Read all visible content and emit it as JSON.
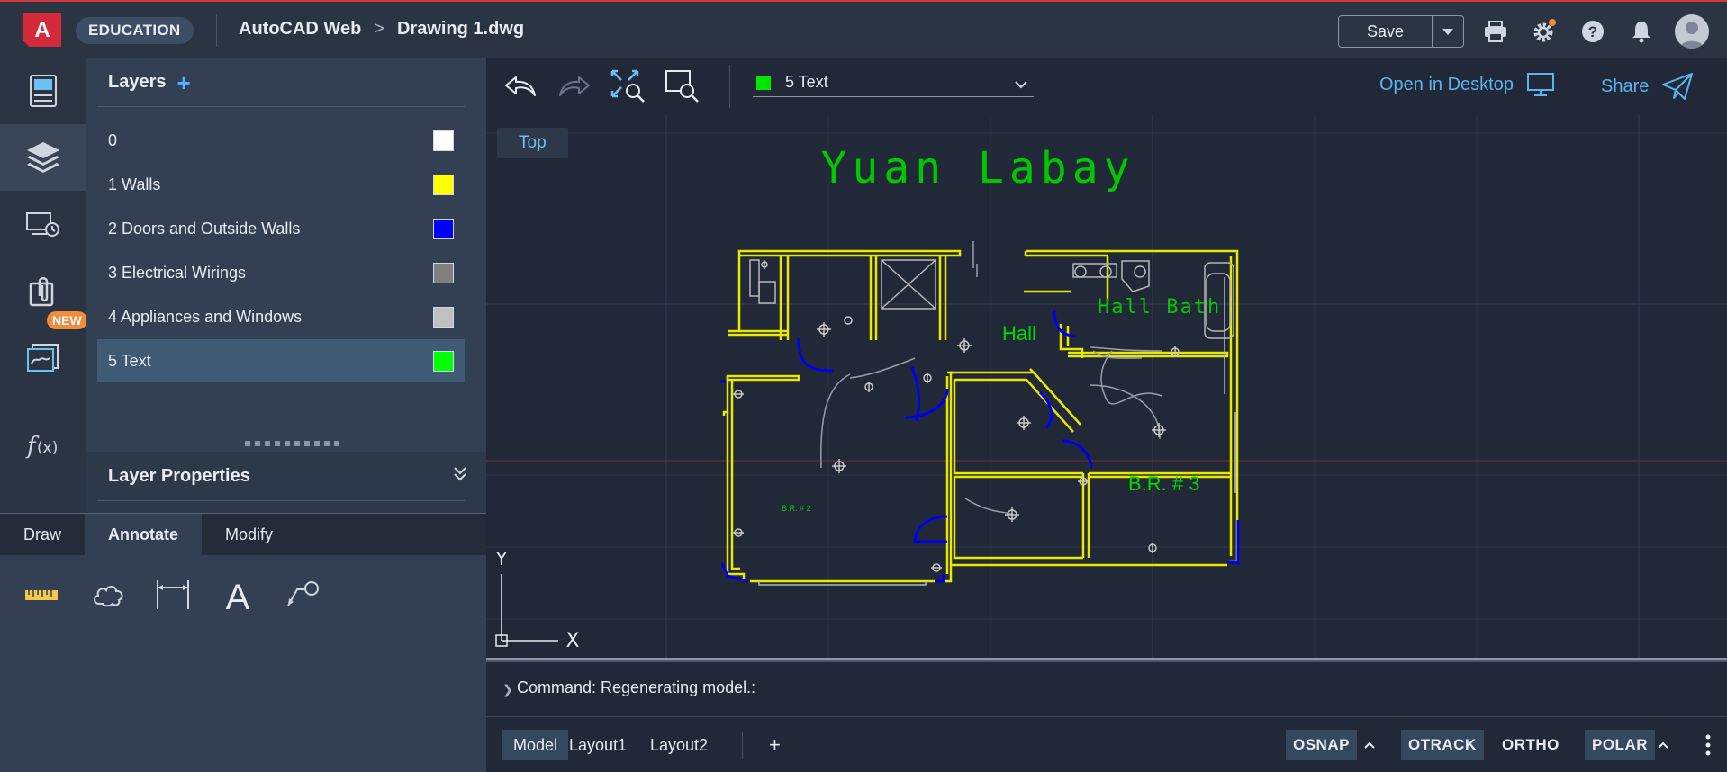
{
  "app": {
    "logo_letter": "A",
    "badge": "EDUCATION",
    "product": "AutoCAD Web",
    "file": "Drawing 1.dwg",
    "save_label": "Save"
  },
  "rail": {
    "new_badge": "NEW"
  },
  "layers": {
    "title": "Layers",
    "add_symbol": "+",
    "items": [
      {
        "name": "0",
        "color": "#ffffff"
      },
      {
        "name": "1 Walls",
        "color": "#ffff00"
      },
      {
        "name": "2 Doors and Outside Walls",
        "color": "#0000ff"
      },
      {
        "name": "3 Electrical Wirings",
        "color": "#808080"
      },
      {
        "name": "4 Appliances and Windows",
        "color": "#c0c0c0"
      },
      {
        "name": "5 Text",
        "color": "#00ff00"
      }
    ],
    "selected_index": 5,
    "properties_title": "Layer Properties"
  },
  "bottom_tabs": {
    "items": [
      "Draw",
      "Annotate",
      "Modify"
    ],
    "active": "Annotate"
  },
  "toolbar": {
    "current_layer": "5 Text",
    "current_layer_color": "#00e600",
    "open_desktop": "Open in Desktop",
    "share": "Share"
  },
  "viewport": {
    "view_label": "Top",
    "drawing_title": "Yuan Labay",
    "rooms": [
      "Hall",
      "Hall Bath",
      "B.R. # 3",
      "B.R. # 2"
    ],
    "ucs_x": "X",
    "ucs_y": "Y"
  },
  "command": {
    "text": "Command: Regenerating model.:"
  },
  "status": {
    "layouts": [
      "Model",
      "Layout1",
      "Layout2"
    ],
    "active_layout": "Model",
    "add_layout": "+",
    "toggles": {
      "osnap": "OSNAP",
      "otrack": "OTRACK",
      "ortho": "ORTHO",
      "polar": "POLAR"
    }
  },
  "colors": {
    "accent": "#5ab4ee",
    "brand": "#d42a3a",
    "wall": "#ffff00",
    "door": "#0000ff",
    "text_layer": "#00ff00"
  }
}
